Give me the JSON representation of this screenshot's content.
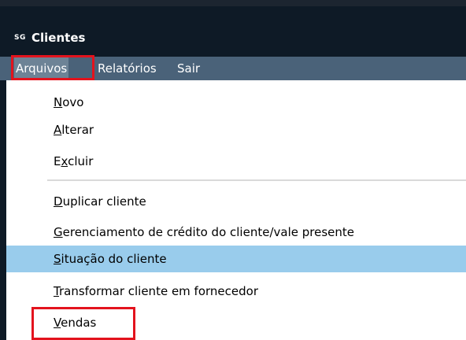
{
  "window": {
    "icon_text": "SG",
    "title": "Clientes"
  },
  "menubar": {
    "items": [
      {
        "label": "Arquivos",
        "active": true,
        "highlighted": true
      },
      {
        "label": "Relatórios"
      },
      {
        "label": "Sair"
      }
    ]
  },
  "dropdown": {
    "groups": [
      [
        {
          "label": "Novo",
          "mnemonic_index": 0
        },
        {
          "label": "Alterar",
          "mnemonic_index": 0
        },
        {
          "label": "Excluir",
          "mnemonic_index": 1
        }
      ],
      [
        {
          "label": "Duplicar cliente",
          "mnemonic_index": 0
        },
        {
          "label": "Gerenciamento de crédito do cliente/vale presente",
          "mnemonic_index": 0
        },
        {
          "label": "Situação do cliente",
          "mnemonic_index": 0,
          "selected": true
        },
        {
          "label": "Transformar cliente em fornecedor",
          "mnemonic_index": 0
        },
        {
          "label": "Vendas",
          "mnemonic_index": 0,
          "highlighted": true
        }
      ]
    ]
  },
  "colors": {
    "titlebar": "#0e1a26",
    "menubar": "#4a6279",
    "selected_item": "#99ccec",
    "highlight_box": "#e3131d"
  }
}
